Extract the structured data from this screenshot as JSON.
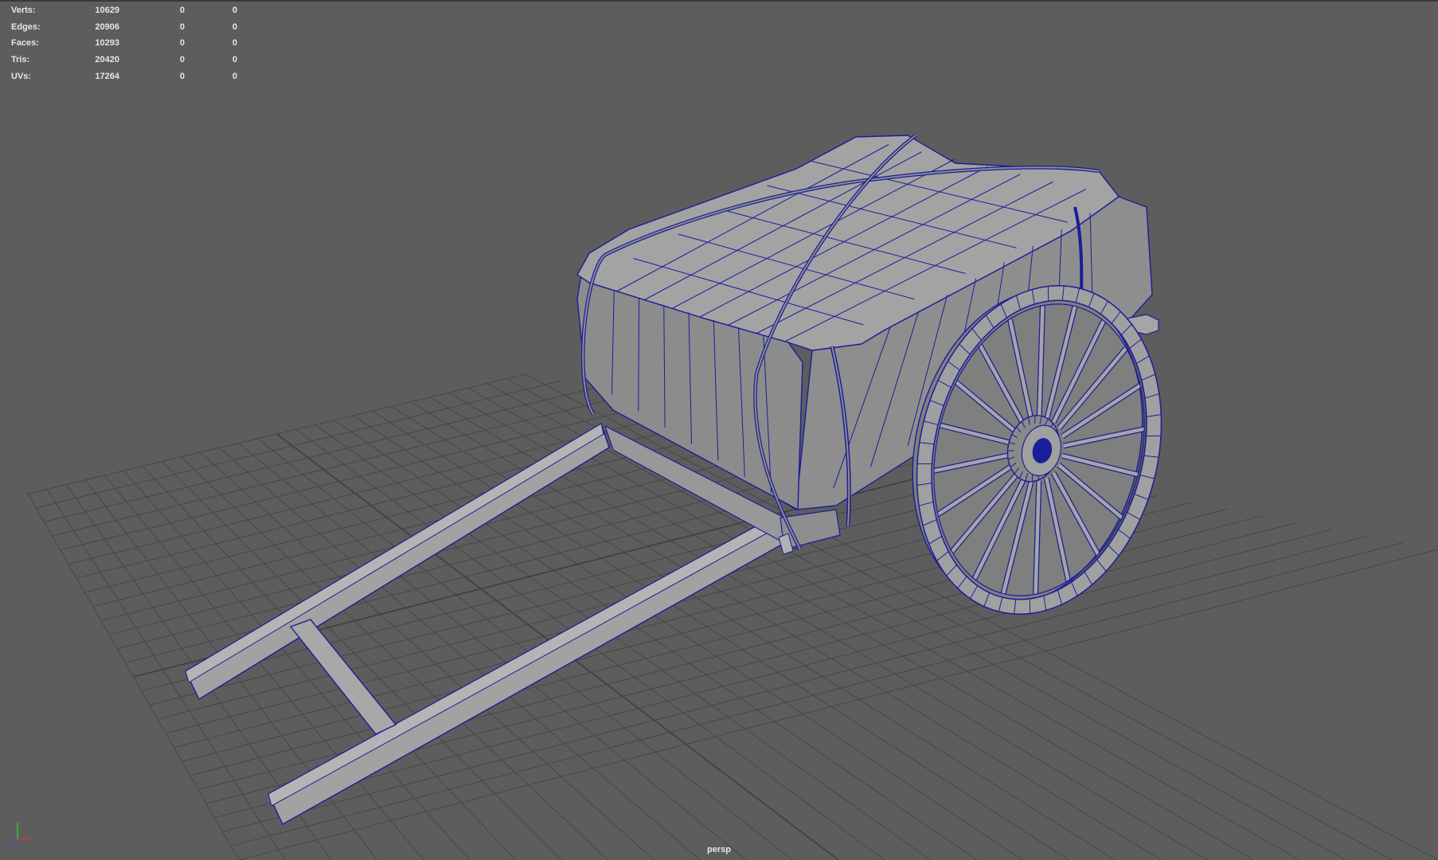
{
  "viewport": {
    "camera": "persp",
    "background": "#5d5d5d",
    "wire_color": "#1b1d9a",
    "mesh_color": "#9a9a9a"
  },
  "hud": {
    "rows": [
      {
        "label": "Verts:",
        "value": "10629",
        "selected": "0",
        "triangles": "0"
      },
      {
        "label": "Edges:",
        "value": "20906",
        "selected": "0",
        "triangles": "0"
      },
      {
        "label": "Faces:",
        "value": "10293",
        "selected": "0",
        "triangles": "0"
      },
      {
        "label": "Tris:",
        "value": "20420",
        "selected": "0",
        "triangles": "0"
      },
      {
        "label": "UVs:",
        "value": "17264",
        "selected": "0",
        "triangles": "0"
      }
    ]
  },
  "axis_gizmo": {
    "x": "x",
    "y": "y",
    "z": "z"
  }
}
